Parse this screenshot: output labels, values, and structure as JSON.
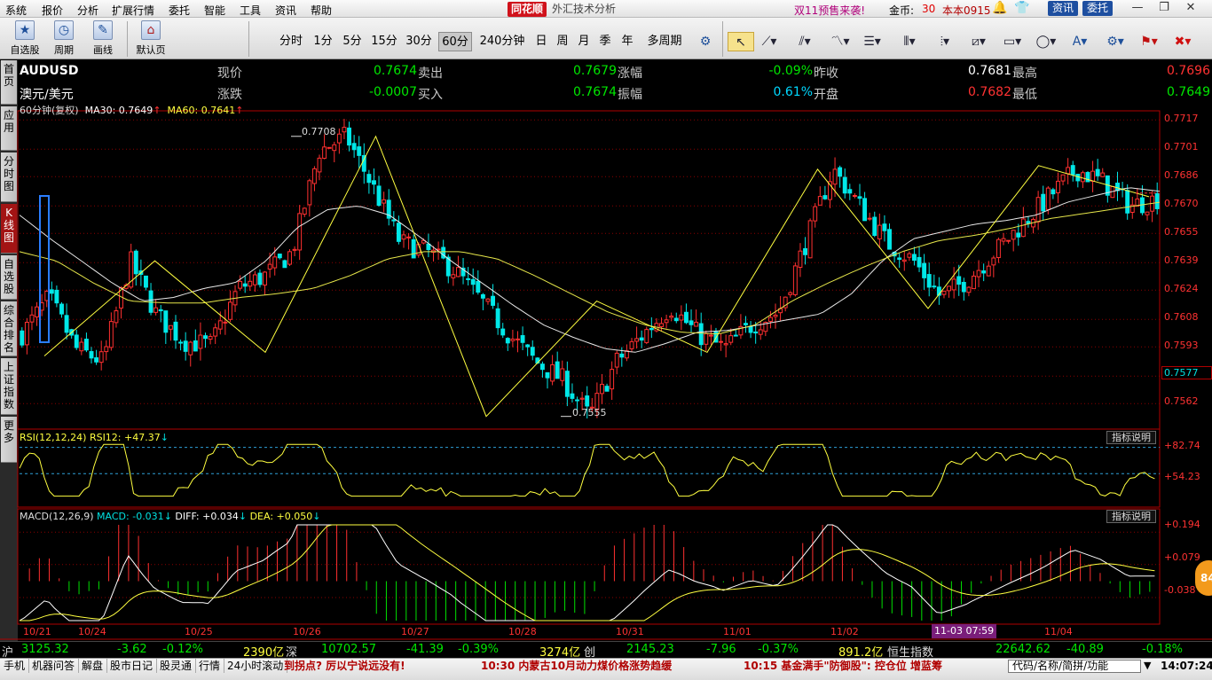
{
  "menu": {
    "items": [
      "系统",
      "报价",
      "分析",
      "扩展行情",
      "委托",
      "智能",
      "工具",
      "资讯",
      "帮助"
    ],
    "logo": "同花顺",
    "title": "外汇技术分析",
    "promo": "双11预售来袭!",
    "coin_label": "金币:",
    "coin_value": "30",
    "version": "本本0915",
    "btn_news": "资讯",
    "btn_trade": "委托"
  },
  "toolbar": {
    "buttons": [
      "自选股",
      "周期",
      "画线",
      "默认页"
    ],
    "periods": [
      "分时",
      "1分",
      "5分",
      "15分",
      "30分",
      "60分",
      "240分钟",
      "日",
      "周",
      "月",
      "季",
      "年",
      "多周期"
    ],
    "active_period": "60分"
  },
  "side_tabs": [
    "首页",
    "应用",
    "分时图",
    "K线图",
    "自选股",
    "综合排名",
    "上证指数",
    "更多"
  ],
  "quote": {
    "symbol": "AUDUSD",
    "name": "澳元/美元",
    "now_label": "现价",
    "now": "0.7674",
    "sell_label": "卖出",
    "sell": "0.7679",
    "chg_pct_label": "涨幅",
    "chg_pct": "-0.09%",
    "prev_label": "昨收",
    "prev": "0.7681",
    "high_label": "最高",
    "high": "0.7696",
    "chg_label": "涨跌",
    "chg": "-0.0007",
    "buy_label": "买入",
    "buy": "0.7674",
    "amp_label": "振幅",
    "amp": "0.61%",
    "open_label": "开盘",
    "open": "0.7682",
    "low_label": "最低",
    "low": "0.7649"
  },
  "ma_legend": {
    "period": "60分钟(复权)",
    "ma30": "MA30: 0.7649",
    "ma60": "MA60: 0.7641"
  },
  "rsi": {
    "title": "RSI(12,12,24)",
    "value": "RSI12: +47.37",
    "levels": [
      "+82.74",
      "+54.23"
    ]
  },
  "macd": {
    "title": "MACD(12,26,9)",
    "macd": "MACD: -0.031",
    "diff": "DIFF: +0.034",
    "dea": "DEA: +0.050",
    "levels": [
      "+0.194",
      "+0.079",
      "-0.038"
    ]
  },
  "indicator_btn": "指标说明",
  "price_axis": [
    "0.7717",
    "0.7701",
    "0.7686",
    "0.7670",
    "0.7655",
    "0.7639",
    "0.7624",
    "0.7608",
    "0.7593",
    "0.7577",
    "0.7562"
  ],
  "current_price_tag": "0.7577",
  "annot": {
    "high": "0.7708",
    "low": "0.7555"
  },
  "dates": [
    "10/21",
    "10/24",
    "10/25",
    "10/26",
    "10/27",
    "10/28",
    "10/31",
    "11/01",
    "11/02",
    "11/04"
  ],
  "cursor_date": "11-03 07:59",
  "badge": "84",
  "index_bar": {
    "sh_label": "沪",
    "sh": "3125.32",
    "sh_chg": "-3.62",
    "sh_pct": "-0.12%",
    "sh_amt": "2390亿",
    "sz_label": "深",
    "sz": "10702.57",
    "sz_chg": "-41.39",
    "sz_pct": "-0.39%",
    "sz_amt": "3274亿",
    "cy_label": "创",
    "cy": "2145.23",
    "cy_chg": "-7.96",
    "cy_pct": "-0.37%",
    "cy_amt": "891.2亿",
    "hs_label": "恒生指数",
    "hs": "22642.62",
    "hs_chg": "-40.89",
    "hs_pct": "-0.18%"
  },
  "status": {
    "tabs": [
      "手机",
      "机器问答",
      "解盘",
      "股市日记",
      "股灵通",
      "行情",
      "24小时滚动"
    ],
    "news1": "到拐点? 厉以宁说远没有!",
    "news2": "10:30 内蒙古10月动力煤价格涨势趋缓",
    "news3": "10:15 基金满手\"防御股\": 控仓位 增蓝筹",
    "search_placeholder": "代码/名称/简拼/功能",
    "clock": "14:07:24"
  },
  "chart_data": {
    "type": "candlestick",
    "instrument": "AUDUSD",
    "timeframe": "60min",
    "ylim": [
      0.755,
      0.772
    ],
    "y_ticks": [
      0.7717,
      0.7701,
      0.7686,
      0.767,
      0.7655,
      0.7639,
      0.7624,
      0.7608,
      0.7593,
      0.7577,
      0.7562
    ],
    "date_labels": [
      "10/21",
      "10/24",
      "10/25",
      "10/26",
      "10/27",
      "10/28",
      "10/31",
      "11/01",
      "11/02",
      "11/04"
    ],
    "close_path": [
      0.76,
      0.762,
      0.7592,
      0.7585,
      0.764,
      0.761,
      0.7596,
      0.7594,
      0.7625,
      0.7632,
      0.7645,
      0.77,
      0.7708,
      0.768,
      0.765,
      0.7645,
      0.7635,
      0.7618,
      0.76,
      0.7585,
      0.7575,
      0.7555,
      0.7585,
      0.76,
      0.7615,
      0.76,
      0.7592,
      0.7605,
      0.7612,
      0.765,
      0.769,
      0.767,
      0.765,
      0.764,
      0.762,
      0.763,
      0.7645,
      0.766,
      0.7675,
      0.769,
      0.7683,
      0.767,
      0.7674
    ],
    "ma30_path": [
      0.7665,
      0.7652,
      0.764,
      0.7628,
      0.7618,
      0.762,
      0.7625,
      0.7628,
      0.764,
      0.7658,
      0.7668,
      0.767,
      0.7665,
      0.7653,
      0.764,
      0.7628,
      0.7616,
      0.7605,
      0.7598,
      0.7592,
      0.759,
      0.7595,
      0.7601,
      0.7602,
      0.7605,
      0.7608,
      0.7611,
      0.7622,
      0.764,
      0.7652,
      0.7656,
      0.766,
      0.7662,
      0.7665,
      0.7672,
      0.7676,
      0.768,
      0.7678
    ],
    "ma60_path": [
      0.7645,
      0.764,
      0.7628,
      0.7618,
      0.7617,
      0.7617,
      0.762,
      0.7622,
      0.7625,
      0.7632,
      0.7641,
      0.7645,
      0.7645,
      0.7641,
      0.7632,
      0.7622,
      0.7612,
      0.7605,
      0.7601,
      0.76,
      0.7605,
      0.7618,
      0.7628,
      0.7637,
      0.7645,
      0.7651,
      0.7654,
      0.7658,
      0.7663,
      0.7666,
      0.7669,
      0.7672
    ],
    "zigzag": [
      0.7588,
      0.764,
      0.759,
      0.7708,
      0.7555,
      0.7618,
      0.759,
      0.769,
      0.7614,
      0.7692,
      0.7675
    ],
    "high": 0.7708,
    "low": 0.7555,
    "rsi": {
      "name": "RSI12",
      "last": 47.37,
      "levels": [
        82.74,
        54.23
      ]
    },
    "macd": {
      "macd": -0.031,
      "diff": 0.034,
      "dea": 0.05,
      "levels": [
        0.194,
        0.079,
        -0.038
      ]
    }
  }
}
